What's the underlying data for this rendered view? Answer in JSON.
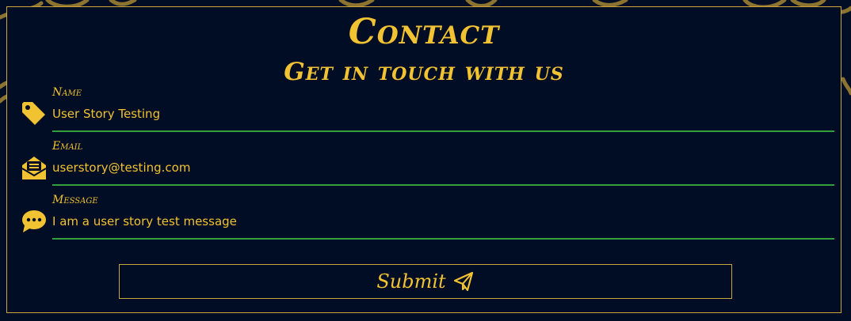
{
  "header": {
    "title": "Contact",
    "subtitle": "Get in touch with us"
  },
  "form": {
    "fields": [
      {
        "label": "Name",
        "value": "User Story Testing",
        "icon": "tag-icon"
      },
      {
        "label": "Email",
        "value": "userstory@testing.com",
        "icon": "envelope-open-icon"
      },
      {
        "label": "Message",
        "value": "I am a user story test message",
        "icon": "comment-dots-icon"
      }
    ],
    "submit_label": "Submit",
    "submit_icon": "paper-plane-icon"
  },
  "colors": {
    "background": "#000d24",
    "accent": "#f1c232",
    "underline": "#2ea03c",
    "border": "#c9a73c"
  }
}
